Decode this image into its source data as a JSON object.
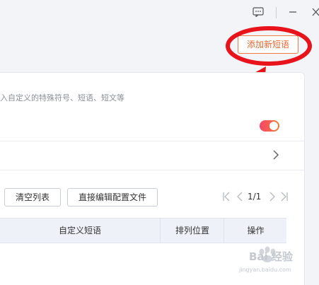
{
  "header": {
    "add_button_label": "添加新短语"
  },
  "window_controls": {
    "chat": "chat-bubble-icon",
    "minimize": "minimize-icon",
    "close": "close-icon"
  },
  "settings": {
    "description": "入自定义的特殊符号、短语、短文等",
    "toggle_on": true,
    "accent_gradient": [
      "#f5456b",
      "#f87b32"
    ]
  },
  "toolbar": {
    "clear_label": "清空列表",
    "edit_config_label": "直接编辑配置文件"
  },
  "pagination": {
    "current": "1/1"
  },
  "table": {
    "columns": [
      "自定义短语",
      "排列位置",
      "操作"
    ]
  },
  "watermark": {
    "brand": "Bai 经验",
    "url": "jingyan.baidu.com"
  },
  "colors": {
    "accent": "#e8672f",
    "annotation": "#e8131b"
  }
}
